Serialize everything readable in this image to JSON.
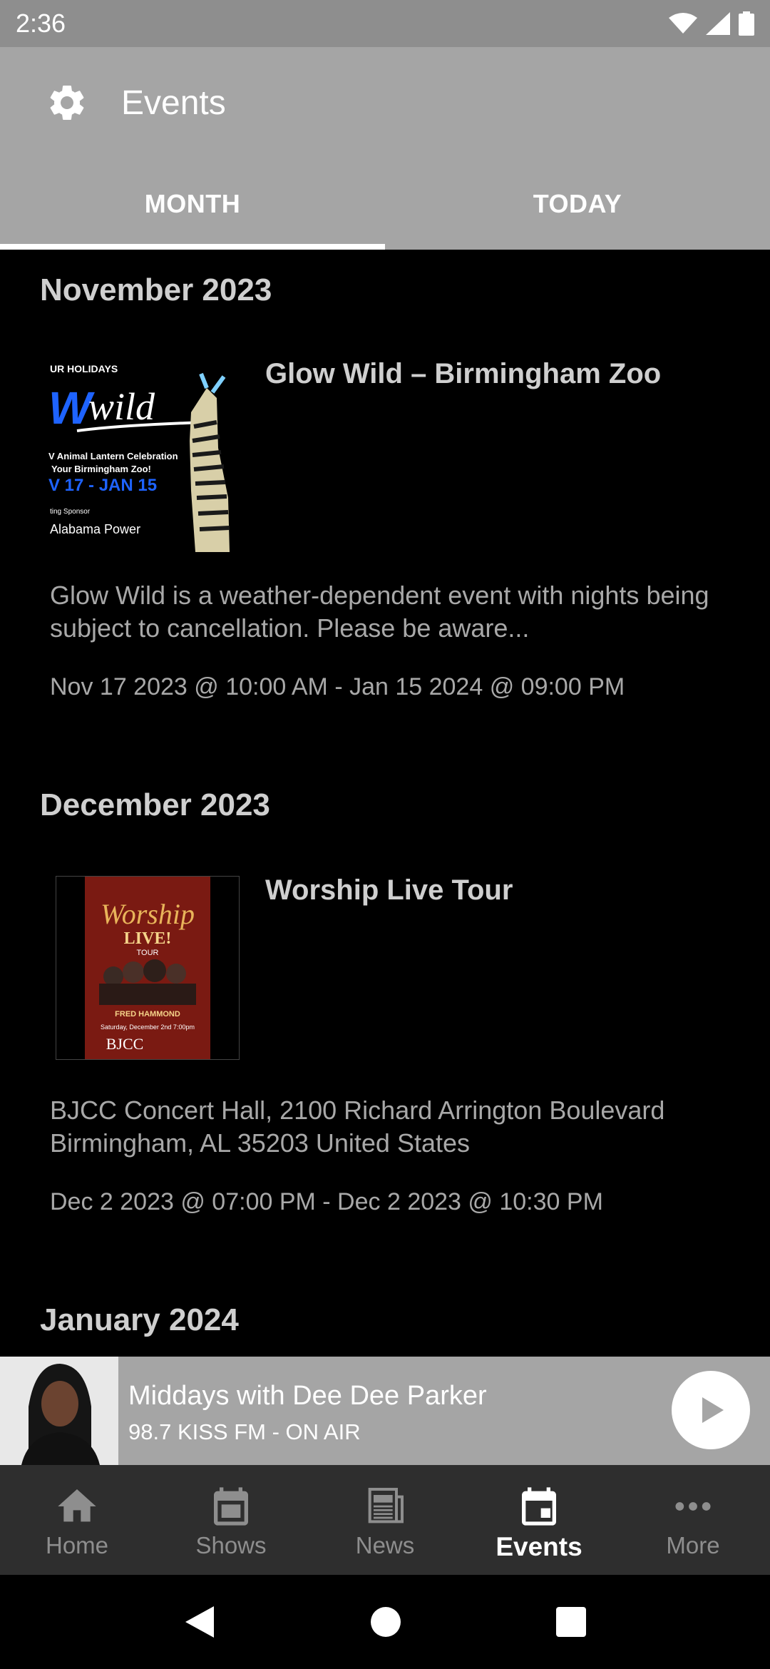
{
  "status_bar": {
    "time": "2:36"
  },
  "app_bar": {
    "title": "Events",
    "settings_icon": "gear-icon"
  },
  "tabs": [
    {
      "label": "MONTH",
      "active": true
    },
    {
      "label": "TODAY",
      "active": false
    }
  ],
  "months": [
    {
      "header": "November 2023",
      "events": [
        {
          "title": "Glow Wild – Birmingham Zoo",
          "description": "  Glow Wild is a weather-dependent event with nights being subject to cancellation.  Please be aware...",
          "dates": "Nov 17 2023 @ 10:00 AM - Jan 15 2024 @ 09:00 PM",
          "thumb_text": {
            "line1": "UR HOLIDAYS",
            "logo": "Wwild",
            "line3": "V Animal Lantern Celebration",
            "line4": "Your Birmingham Zoo!",
            "dates": "V 17 - JAN 15",
            "sponsor_label": "ting Sponsor",
            "sponsor": "Alabama Power"
          }
        }
      ]
    },
    {
      "header": "December 2023",
      "events": [
        {
          "title": "Worship Live Tour",
          "description": "BJCC Concert Hall, 2100 Richard Arrington Boulevard          Birmingham, AL  35203 United States",
          "dates": "Dec 2 2023 @ 07:00 PM - Dec 2 2023 @ 10:30 PM",
          "thumb_text": {
            "title": "Worship",
            "subtitle": "LIVE!",
            "tour": "TOUR",
            "headliner": "FRED HAMMOND",
            "date_line": "Saturday, December 2nd  7:00pm",
            "venue": "BJCC"
          }
        }
      ]
    },
    {
      "header": "January 2024",
      "events": []
    }
  ],
  "mini_player": {
    "title": "Middays with Dee Dee Parker",
    "subtitle": "98.7 KISS FM - ON AIR",
    "play_icon": "play-icon"
  },
  "bottom_nav": [
    {
      "label": "Home",
      "icon": "home-icon",
      "active": false
    },
    {
      "label": "Shows",
      "icon": "calendar-icon",
      "active": false
    },
    {
      "label": "News",
      "icon": "newspaper-icon",
      "active": false
    },
    {
      "label": "Events",
      "icon": "event-calendar-icon",
      "active": true
    },
    {
      "label": "More",
      "icon": "more-dots-icon",
      "active": false
    }
  ],
  "colors": {
    "app_bar": "#a5a5a5",
    "status_bar": "#8e8e8e",
    "background": "#000000",
    "bottom_nav": "#2e2e2e"
  }
}
